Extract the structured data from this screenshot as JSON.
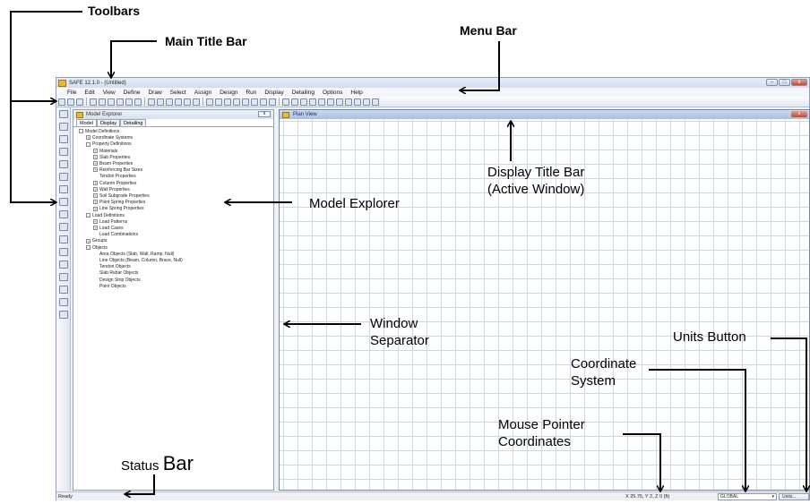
{
  "window": {
    "title": "SAFE 12.1.0 - (Untitled)",
    "controls": [
      "–",
      "□",
      "x"
    ]
  },
  "menu": [
    "File",
    "Edit",
    "View",
    "Define",
    "Draw",
    "Select",
    "Assign",
    "Design",
    "Run",
    "Display",
    "Detailing",
    "Options",
    "Help"
  ],
  "model_explorer": {
    "title": "Model Explorer",
    "close": "x",
    "tabs": [
      "Model",
      "Display",
      "Detailing"
    ],
    "tree": [
      {
        "label": "Model Definitions",
        "level": 0,
        "toggle": "-"
      },
      {
        "label": "Coordinate Systems",
        "level": 1,
        "toggle": "+"
      },
      {
        "label": "Property Definitions",
        "level": 1,
        "toggle": "-"
      },
      {
        "label": "Materials",
        "level": 2,
        "toggle": "+"
      },
      {
        "label": "Slab Properties",
        "level": 2,
        "toggle": "+"
      },
      {
        "label": "Beam Properties",
        "level": 2,
        "toggle": "+"
      },
      {
        "label": "Reinforcing Bar Sizes",
        "level": 2,
        "toggle": "+"
      },
      {
        "label": "Tendon Properties",
        "level": 2,
        "toggle": ""
      },
      {
        "label": "Column Properties",
        "level": 2,
        "toggle": "+"
      },
      {
        "label": "Wall Properties",
        "level": 2,
        "toggle": "+"
      },
      {
        "label": "Soil Subgrade Properties",
        "level": 2,
        "toggle": "+"
      },
      {
        "label": "Point Spring Properties",
        "level": 2,
        "toggle": "+"
      },
      {
        "label": "Line Spring Properties",
        "level": 2,
        "toggle": "+"
      },
      {
        "label": "Load Definitions",
        "level": 1,
        "toggle": "-"
      },
      {
        "label": "Load Patterns",
        "level": 2,
        "toggle": "+"
      },
      {
        "label": "Load Cases",
        "level": 2,
        "toggle": "+"
      },
      {
        "label": "Load Combinations",
        "level": 2,
        "toggle": ""
      },
      {
        "label": "Groups",
        "level": 1,
        "toggle": "+"
      },
      {
        "label": "Objects",
        "level": 1,
        "toggle": "-"
      },
      {
        "label": "Area Objects (Slab, Wall, Ramp, Null)",
        "level": 2,
        "toggle": ""
      },
      {
        "label": "Line Objects (Beam, Column, Brace, Null)",
        "level": 2,
        "toggle": ""
      },
      {
        "label": "Tendon Objects",
        "level": 2,
        "toggle": ""
      },
      {
        "label": "Slab Rebar Objects",
        "level": 2,
        "toggle": ""
      },
      {
        "label": "Design Strip Objects",
        "level": 2,
        "toggle": ""
      },
      {
        "label": "Point Objects",
        "level": 2,
        "toggle": ""
      }
    ]
  },
  "plan_view": {
    "title": "Plan View",
    "close": "x"
  },
  "status_bar": {
    "status": "Ready",
    "coordinates": "X 25.75,  Y 2,  Z 0  (ft)",
    "coord_system": "GLOBAL",
    "units_button": "Units..."
  },
  "annotations": {
    "toolbars": "Toolbars",
    "main_title_bar": "Main Title Bar",
    "menu_bar": "Menu Bar",
    "display_title_bar": [
      "Display Title Bar",
      "(Active Window)"
    ],
    "model_explorer": "Model Explorer",
    "window_separator": [
      "Window",
      "Separator"
    ],
    "units_button": "Units Button",
    "coordinate_system": [
      "Coordinate",
      "System"
    ],
    "mouse_pointer": [
      "Mouse Pointer",
      "Coordinates"
    ],
    "status_bar_word1": "Status",
    "status_bar_word2": "Bar"
  }
}
